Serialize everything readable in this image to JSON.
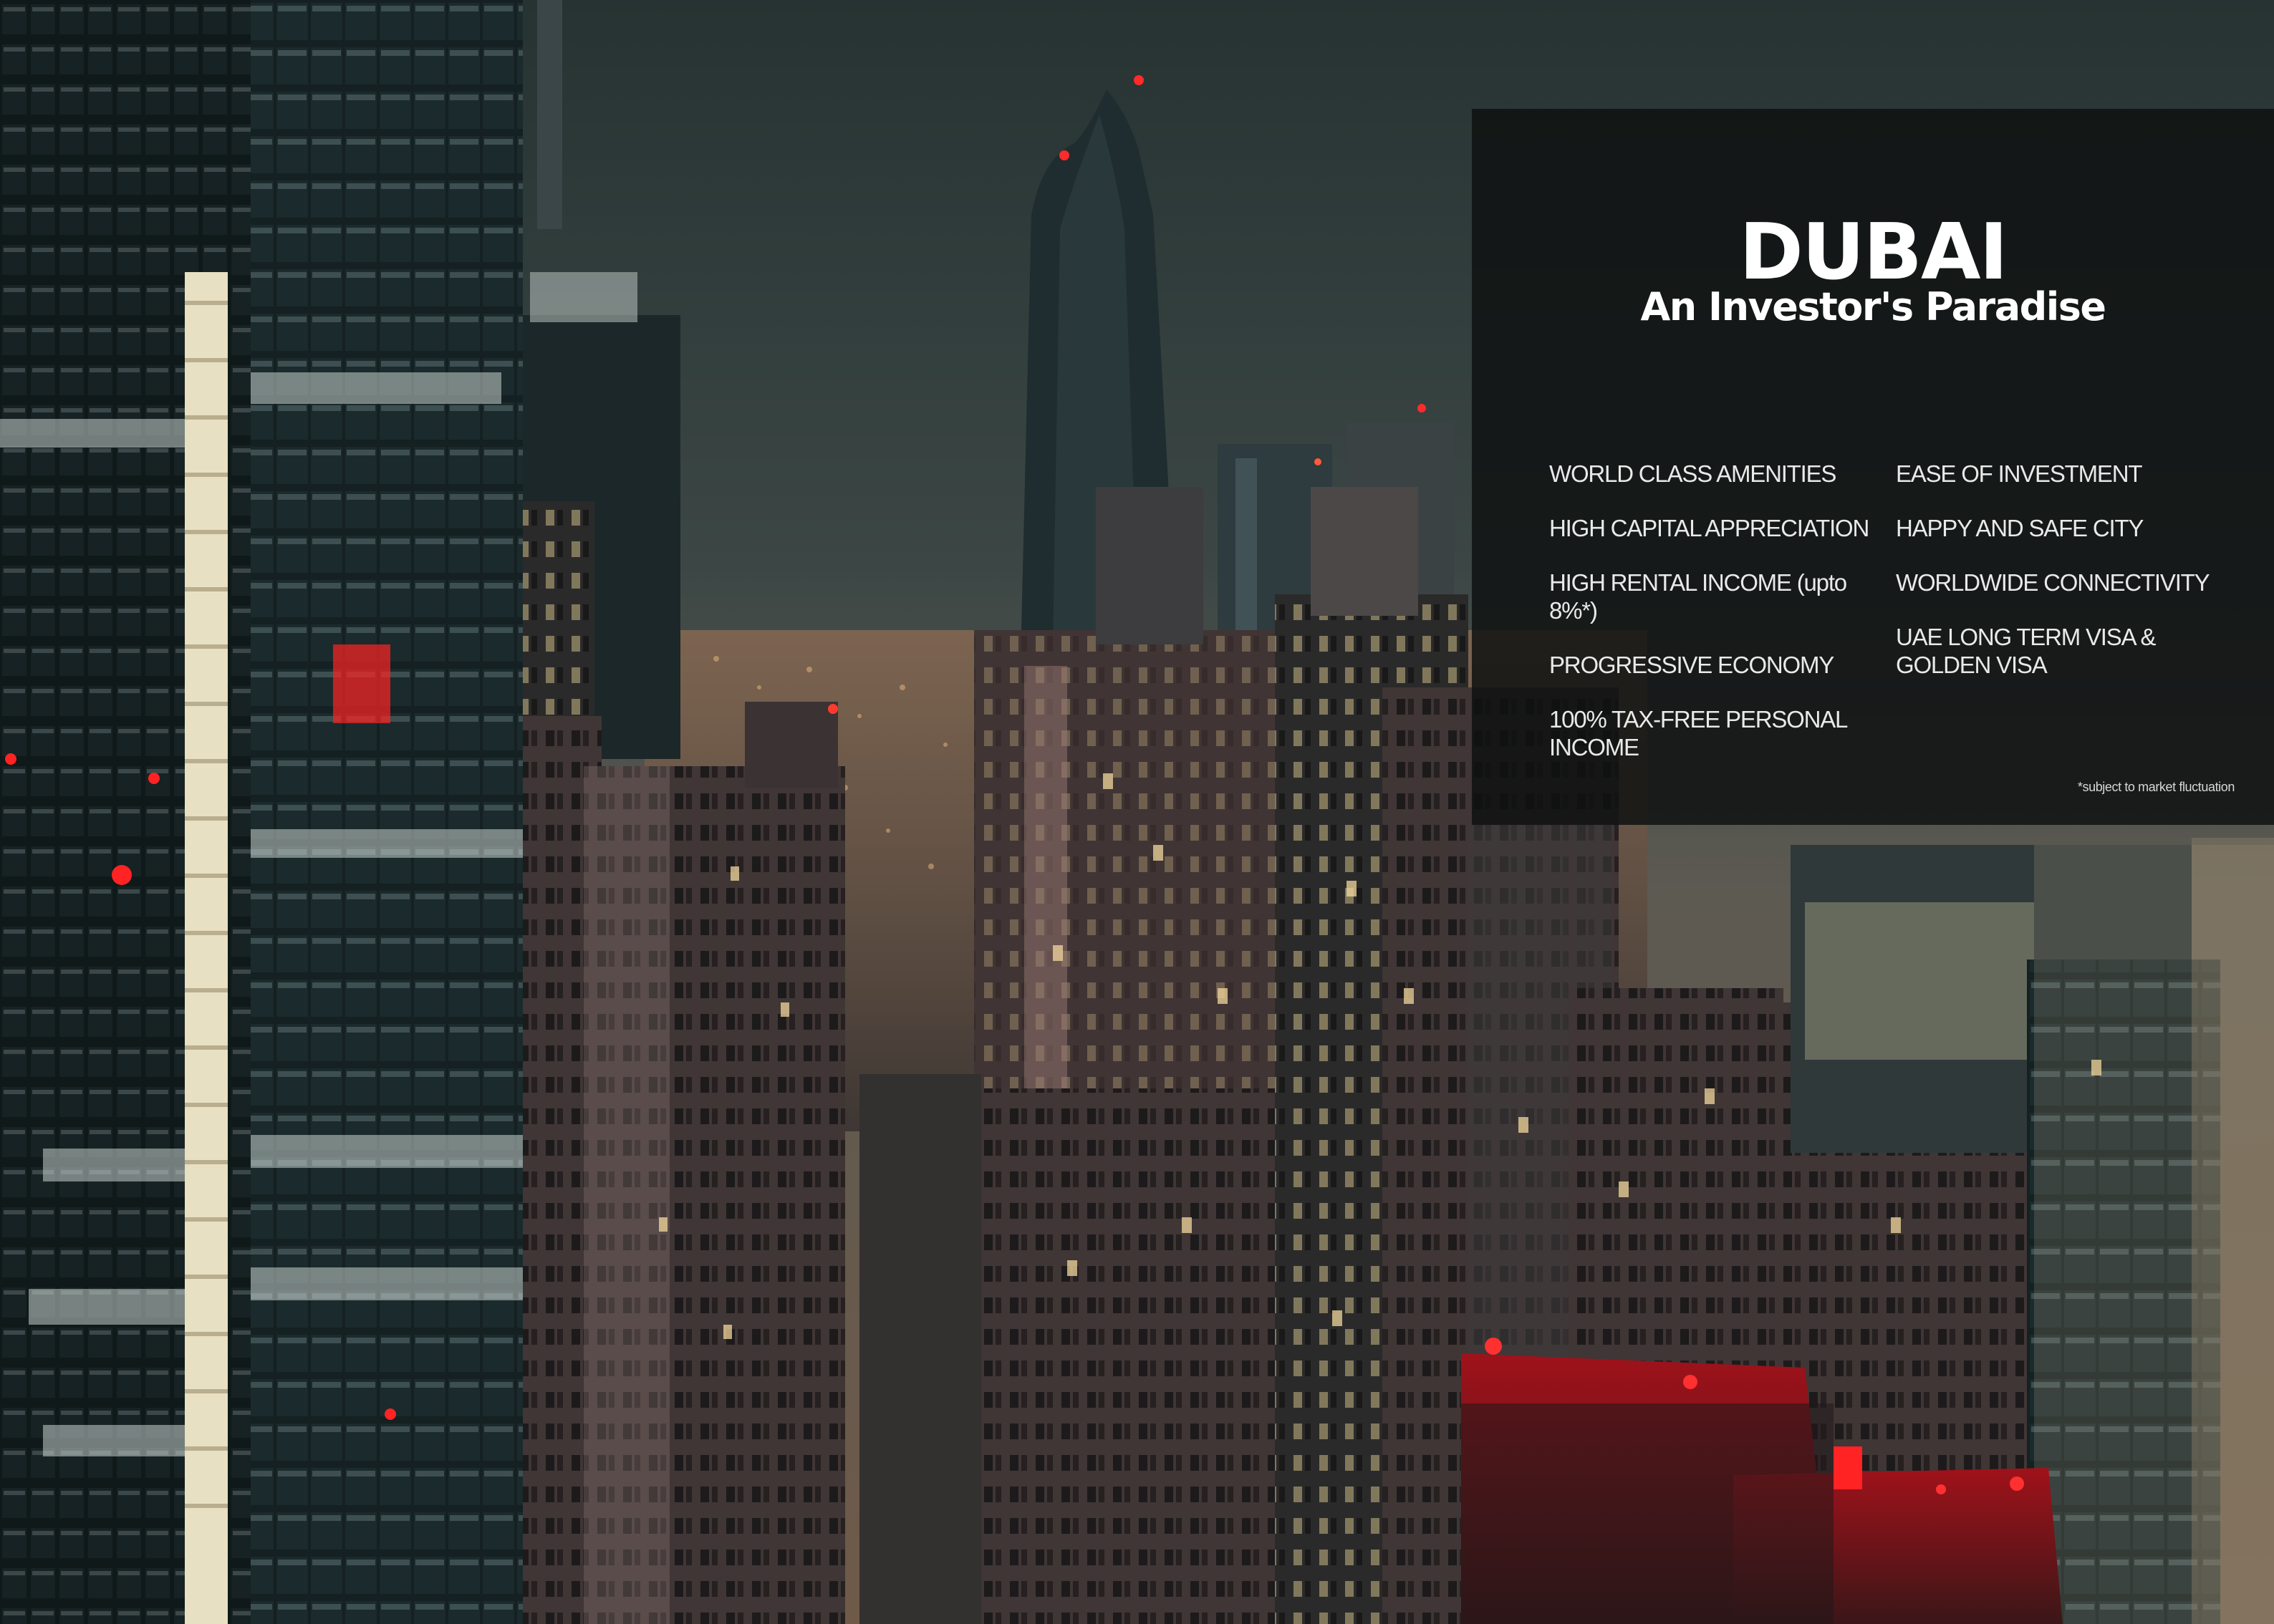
{
  "panel": {
    "title": "DUBAI",
    "subtitle": "An Investor's Paradise",
    "left_items": [
      "WORLD CLASS AMENITIES",
      "HIGH CAPITAL APPRECIATION",
      "HIGH RENTAL INCOME (upto 8%*)",
      "PROGRESSIVE ECONOMY",
      "100% TAX-FREE PERSONAL INCOME"
    ],
    "right_items": [
      "EASE OF INVESTMENT",
      "HAPPY AND SAFE CITY",
      "WORLDWIDE CONNECTIVITY",
      "UAE LONG TERM VISA & GOLDEN VISA"
    ],
    "footnote": "*subject to market fluctuation"
  },
  "colors": {
    "panel_background": "#0e1111",
    "text": "#ffffff",
    "sky": "#33403f",
    "warning_light": "#ff1c22"
  }
}
